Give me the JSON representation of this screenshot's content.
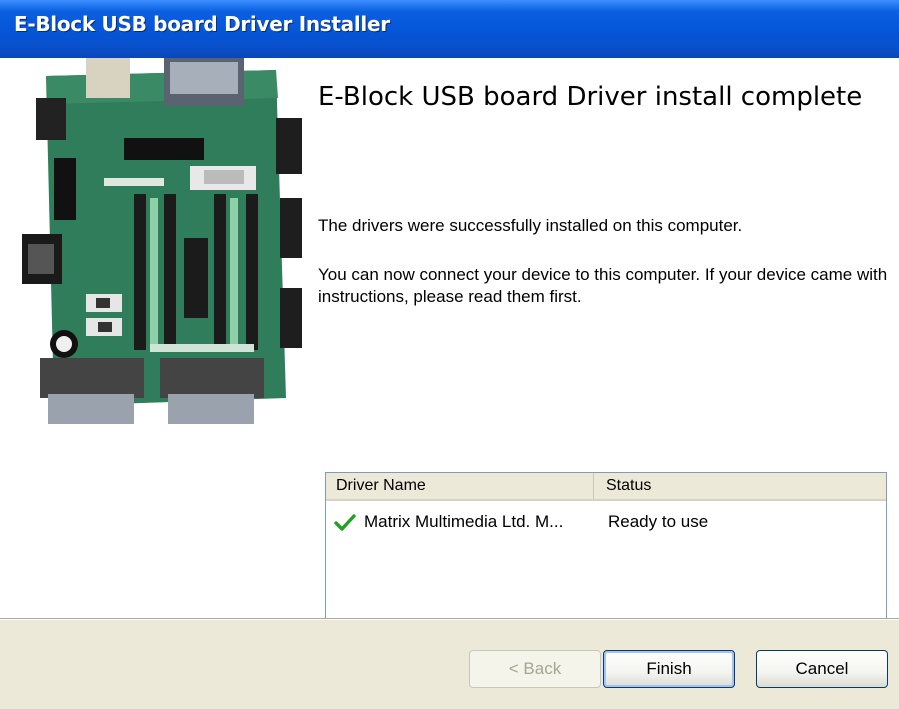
{
  "window": {
    "title": "E-Block USB board Driver Installer"
  },
  "main": {
    "heading": "E-Block USB board Driver install complete",
    "message1": "The drivers were successfully installed on this computer.",
    "message2": "You can now connect your device to this computer. If your device came with instructions, please read them first."
  },
  "driver_list": {
    "columns": [
      "Driver Name",
      "Status"
    ],
    "rows": [
      {
        "name": "Matrix Multimedia Ltd. M...",
        "status": "Ready to use",
        "icon": "checkmark-icon"
      }
    ]
  },
  "buttons": {
    "back": "< Back",
    "finish": "Finish",
    "cancel": "Cancel"
  },
  "colors": {
    "titlebar": "#0554d6",
    "footer": "#ece9d8",
    "check": "#21a121",
    "board": "#2f7d5a"
  }
}
